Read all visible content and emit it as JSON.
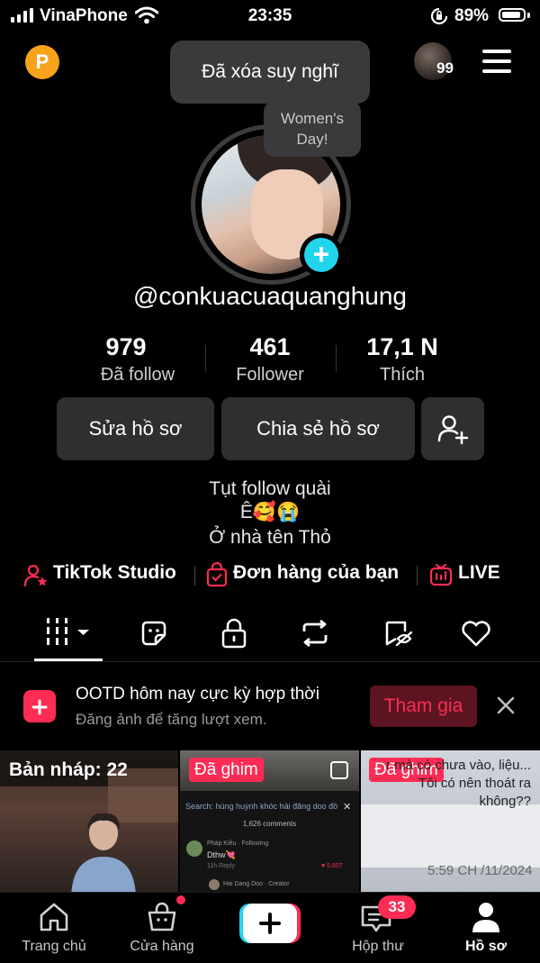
{
  "status_bar": {
    "carrier": "VinaPhone",
    "time": "23:35",
    "battery": "89%",
    "battery_level": 0.89
  },
  "header": {
    "tooltip": "Đã xóa suy nghĩ",
    "avatar_count": "99",
    "points_badge": "P"
  },
  "profile": {
    "bubble": "Women's Day!",
    "bubble_line1": "Women's",
    "bubble_line2": "Day!",
    "username": "@conkuacuaquanghung",
    "stats": [
      {
        "value": "979",
        "label": "Đã follow"
      },
      {
        "value": "461",
        "label": "Follower"
      },
      {
        "value": "17,1 N",
        "label": "Thích"
      }
    ],
    "edit_button": "Sửa hồ sơ",
    "share_button": "Chia sẻ hồ sơ",
    "bio": [
      "Tụt follow quài",
      "Ê🥰😭",
      "Ở nhà tên Thỏ"
    ]
  },
  "links": {
    "studio": "TikTok Studio",
    "orders": "Đơn hàng của bạn",
    "live": "LIVE"
  },
  "banner": {
    "title": "OOTD hôm nay cực kỳ hợp thời",
    "subtitle": "Đăng ảnh để tăng lượt xem.",
    "join": "Tham gia"
  },
  "grid": {
    "draft": "Bản nháp: 22",
    "pin1": "Đã ghim",
    "pin2": "Đã ghim",
    "c2_search": "Search: hùng huỳnh khóc hải đăng doo đồ",
    "c2_comments": "1,626 comments",
    "c2_user": "Pháp Kiều · Following",
    "c2_msg": "Dthw💘",
    "c2_reply": "11h     Reply",
    "c2_likes": "♥ 5,607",
    "c2_author": "Hai Dang Doo · Creator",
    "c3_text": "r mà có chưa vào, liệu... Tôi có nên thoát ra không??",
    "c3_time": "5:59 CH  /11/2024"
  },
  "nav": {
    "home": "Trang chủ",
    "shop": "Cửa hàng",
    "inbox": "Hộp thư",
    "inbox_count": "33",
    "profile": "Hồ sơ"
  },
  "colors": {
    "accent": "#fe2c55",
    "cyan": "#20d5ec",
    "button_bg": "#2f2f2f"
  }
}
